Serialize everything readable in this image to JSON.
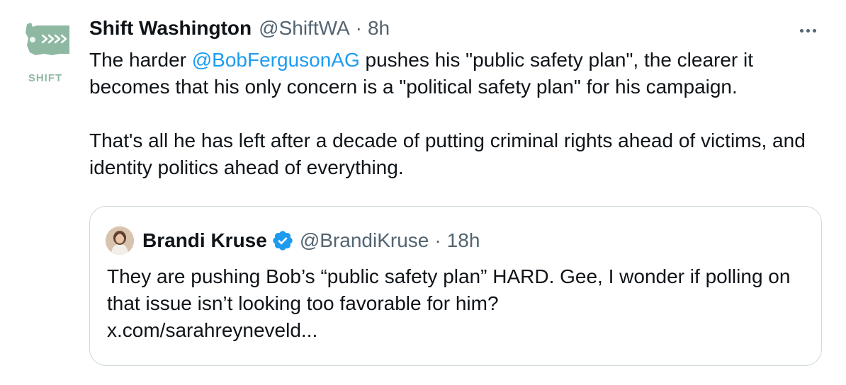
{
  "tweet": {
    "author_name": "Shift Washington",
    "author_handle": "@ShiftWA",
    "separator": "·",
    "time": "8h",
    "avatar_logo_text": "SHIFT",
    "text_part1": "The harder ",
    "mention": "@BobFergusonAG",
    "text_part2": " pushes his \"public safety plan\", the clearer it becomes that his only concern is a \"political safety plan\" for his campaign.",
    "paragraph2": "That's all he has left after a decade of putting criminal rights ahead of victims, and identity politics ahead of everything."
  },
  "quote": {
    "author_name": "Brandi Kruse",
    "author_handle": "@BrandiKruse",
    "separator": "·",
    "time": "18h",
    "text": "They are pushing Bob’s “public safety plan” HARD. Gee, I wonder if polling on that issue isn’t looking too favorable for him?",
    "link": "x.com/sarahreyneveld..."
  },
  "icons": {
    "more": "more-horizontal-icon",
    "verified": "verified-badge-icon"
  },
  "colors": {
    "link_blue": "#1d9bf0",
    "secondary_text": "#536471",
    "border": "#cfd9de",
    "brand_green": "#8fb8a3"
  }
}
